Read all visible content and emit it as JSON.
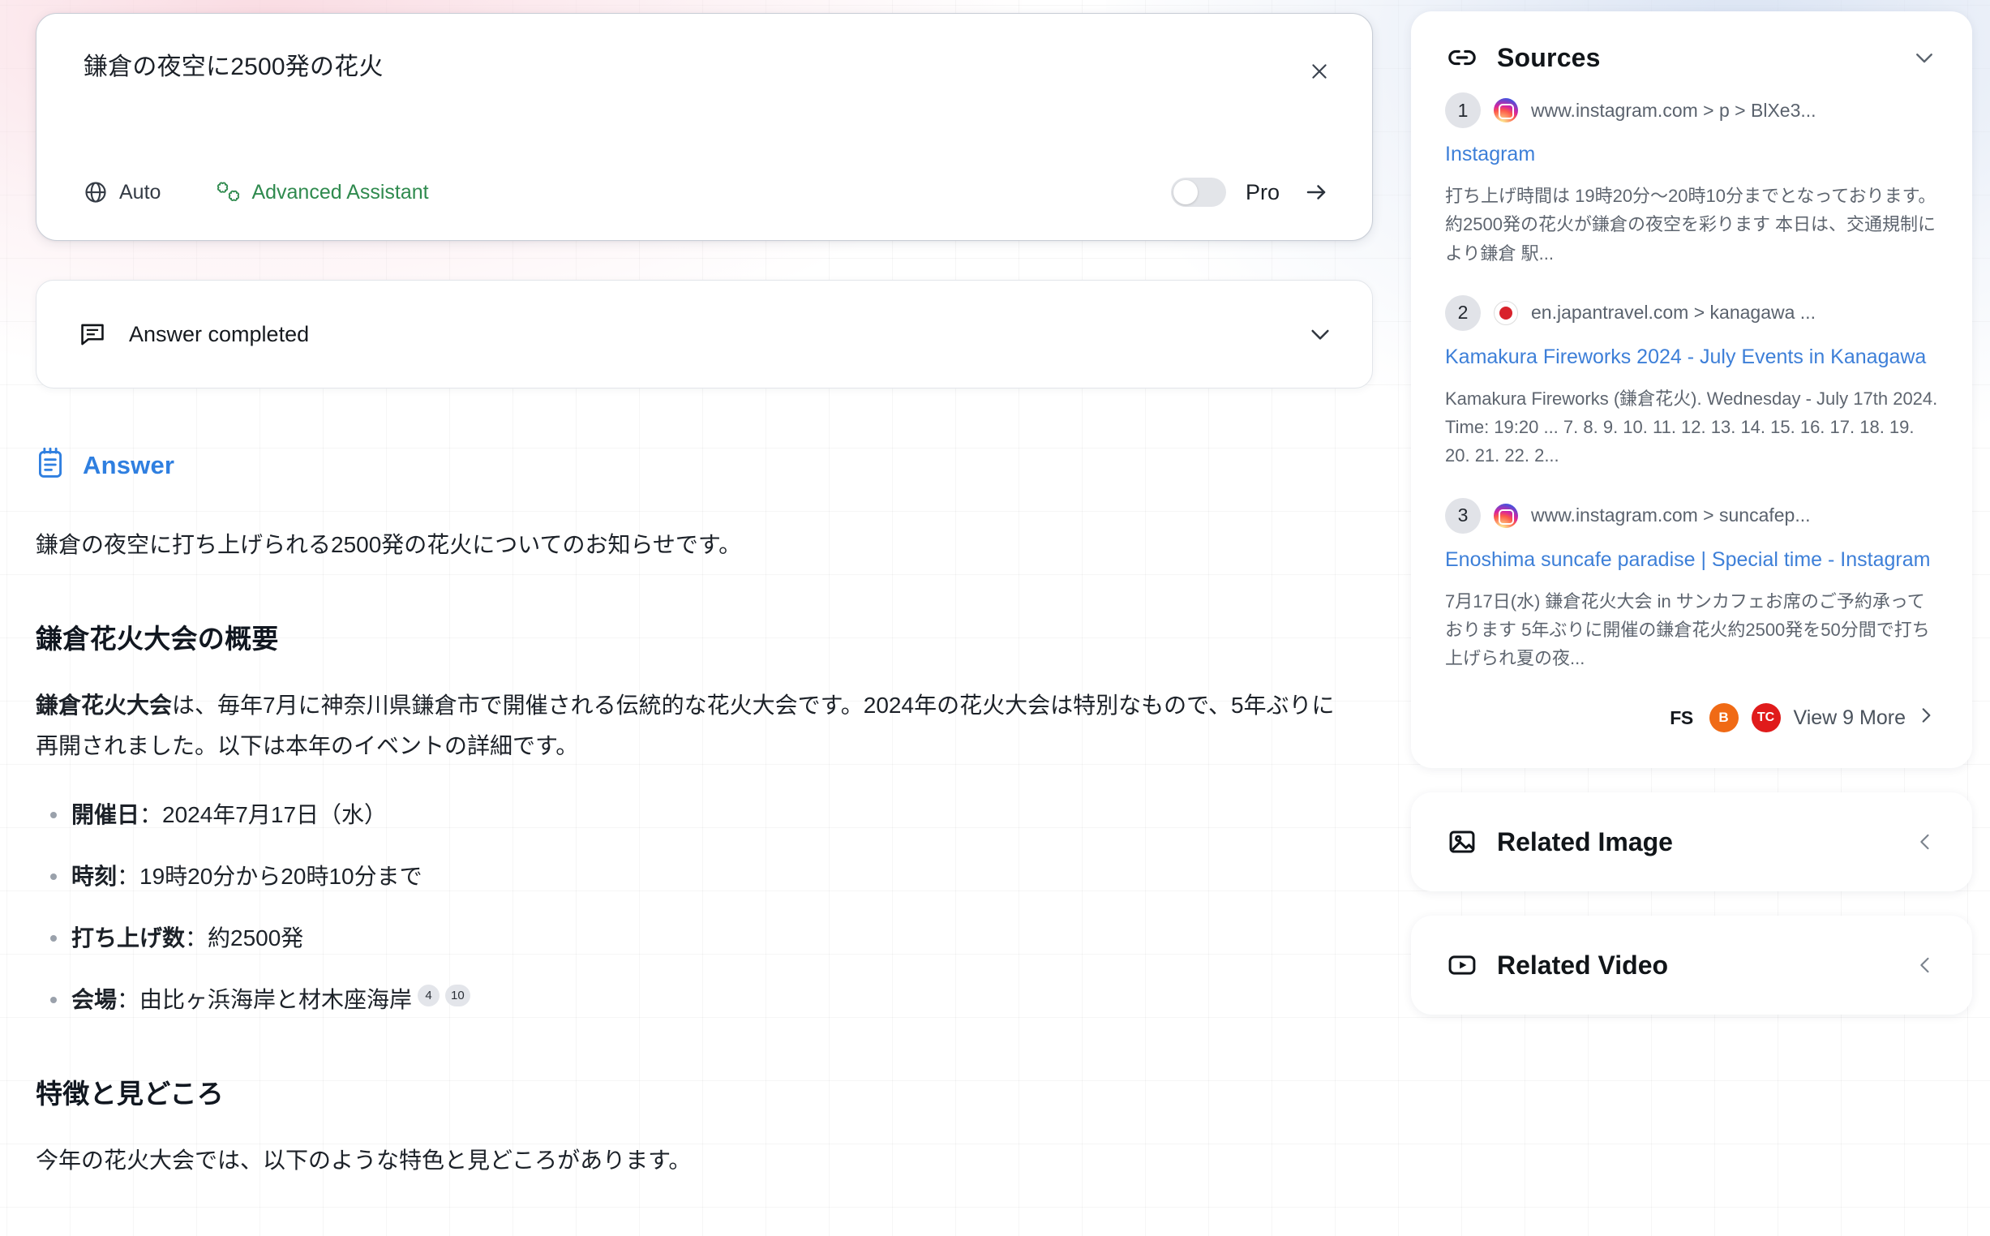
{
  "prompt": {
    "query": "鎌倉の夜空に2500発の花火",
    "close_label": "×",
    "mode_label": "Auto",
    "assistant_label": "Advanced Assistant",
    "pro_label": "Pro",
    "pro_enabled": false,
    "accent_green": "#2f8a4e"
  },
  "status": {
    "label": "Answer completed"
  },
  "answer": {
    "heading": "Answer",
    "heading_color": "#2f7fe0",
    "intro": "鎌倉の夜空に打ち上げられる2500発の花火についてのお知らせです。",
    "sections": [
      {
        "title": "鎌倉花火大会の概要",
        "paragraph_bold": "鎌倉花火大会",
        "paragraph_rest": "は、毎年7月に神奈川県鎌倉市で開催される伝統的な花火大会です。2024年の花火大会は特別なもので、5年ぶりに再開されました。以下は本年のイベントの詳細です。",
        "bullets": [
          {
            "label": "開催日",
            "value": "：2024年7月17日（水）",
            "cites": []
          },
          {
            "label": "時刻",
            "value": "：19時20分から20時10分まで",
            "cites": []
          },
          {
            "label": "打ち上げ数",
            "value": "：約2500発",
            "cites": []
          },
          {
            "label": "会場",
            "value": "：由比ヶ浜海岸と材木座海岸",
            "cites": [
              "4",
              "10"
            ]
          }
        ]
      },
      {
        "title": "特徴と見どころ",
        "paragraph_bold": "",
        "paragraph_rest": "今年の花火大会では、以下のような特色と見どころがあります。",
        "bullets": []
      }
    ]
  },
  "sources": {
    "title": "Sources",
    "items": [
      {
        "num": "1",
        "favicon": "instagram-favicon",
        "url": "www.instagram.com > p > BlXe3...",
        "title": "Instagram",
        "snippet": "打ち上げ時間は 19時20分〜20時10分までとなっております。 約2500発の花火が鎌倉の夜空を彩ります 本日は、交通規制により鎌倉 駅..."
      },
      {
        "num": "2",
        "favicon": "japantravel-favicon",
        "url": "en.japantravel.com > kanagawa ...",
        "title": "Kamakura Fireworks 2024 - July Events in Kanagawa",
        "snippet": "Kamakura Fireworks (鎌倉花火). Wednesday - July 17th 2024. Time: 19:20 ... 7. 8. 9. 10. 11. 12. 13. 14. 15. 16. 17. 18. 19. 20. 21. 22. 2..."
      },
      {
        "num": "3",
        "favicon": "instagram-favicon",
        "url": "www.instagram.com > suncafep...",
        "title": "Enoshima suncafe paradise | Special time - Instagram",
        "snippet": "7月17日(水) 鎌倉花火大会 in サンカフェお席のご予約承っております 5年ぶりに開催の鎌倉花火約2500発を50分間で打ち上げられ夏の夜..."
      }
    ],
    "footer_icons": [
      {
        "name": "fs-icon",
        "label": "FS",
        "color": "#14181d"
      },
      {
        "name": "blogger-icon",
        "label": "B",
        "color": "#f06a15"
      },
      {
        "name": "tc-icon",
        "label": "TC",
        "color": "#e01b1b"
      }
    ],
    "view_more_label": "View 9 More"
  },
  "related_image": {
    "title": "Related Image"
  },
  "related_video": {
    "title": "Related Video"
  }
}
